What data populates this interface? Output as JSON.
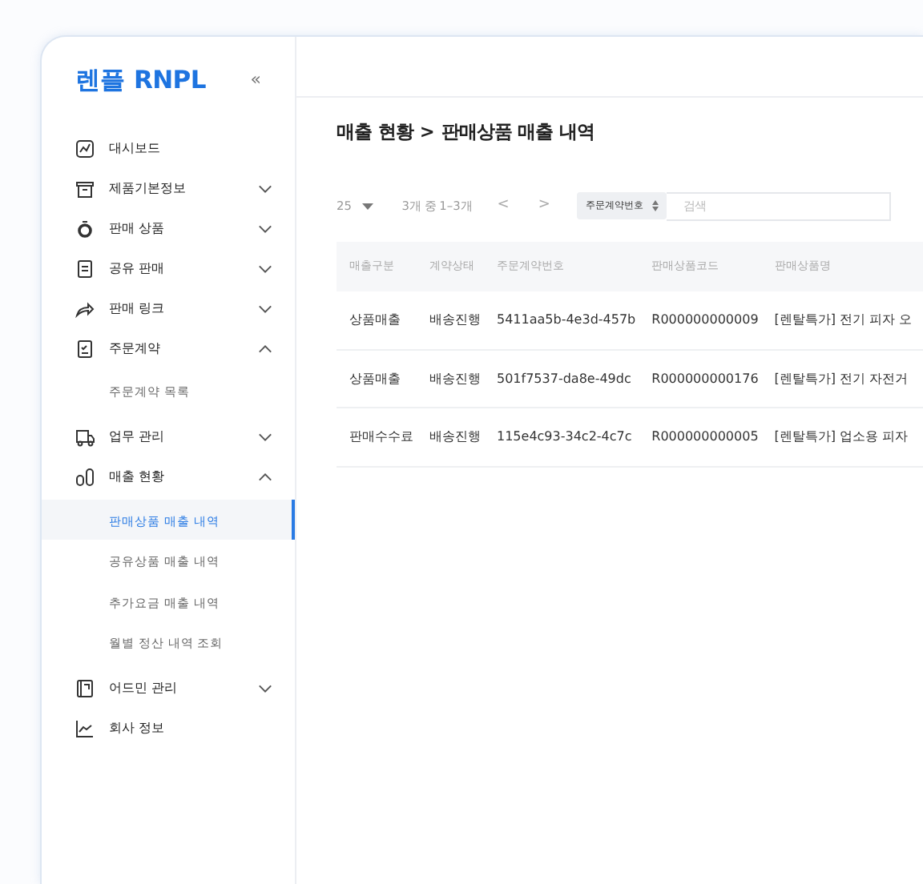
{
  "logo": "렌플 RNPL",
  "collapse": "«",
  "sidebar": {
    "items": [
      {
        "label": "대시보드"
      },
      {
        "label": "제품기본정보",
        "expanded": false
      },
      {
        "label": "판매 상품",
        "expanded": false
      },
      {
        "label": "공유 판매",
        "expanded": false
      },
      {
        "label": "판매 링크",
        "expanded": false
      },
      {
        "label": "주문계약",
        "expanded": true,
        "children": [
          {
            "label": "주문계약 목록",
            "selected": false
          }
        ]
      },
      {
        "label": "업무 관리",
        "expanded": false
      },
      {
        "label": "매출 현황",
        "expanded": true,
        "children": [
          {
            "label": "판매상품 매출 내역",
            "selected": true
          },
          {
            "label": "공유상품 매출 내역",
            "selected": false
          },
          {
            "label": "추가요금 매출 내역",
            "selected": false
          },
          {
            "label": "월별 정산 내역 조회",
            "selected": false
          }
        ]
      },
      {
        "label": "어드민 관리",
        "expanded": false
      },
      {
        "label": "회사 정보"
      }
    ]
  },
  "page_title": "매출 현황 > 판매상품 매출 내역",
  "toolbar": {
    "page_size": "25",
    "range": "3개 중 1–3개",
    "prev": "<",
    "next": ">",
    "search_field": "주문계약번호",
    "search": {
      "placeholder": "검색"
    }
  },
  "table": {
    "columns": [
      "매출구분",
      "계약상태",
      "주문계약번호",
      "판매상품코드",
      "판매상품명"
    ],
    "rows": [
      [
        "상품매출",
        "배송진행",
        "5411aa5b-4e3d-457b",
        "R000000000009",
        "[렌탈특가] 전기 피자 오"
      ],
      [
        "상품매출",
        "배송진행",
        "501f7537-da8e-49dc",
        "R000000000176",
        "[렌탈특가] 전기 자전거"
      ],
      [
        "판매수수료",
        "배송진행",
        "115e4c93-34c2-4c7c",
        "R000000000005",
        "[렌탈특가] 업소용 피자"
      ]
    ]
  }
}
